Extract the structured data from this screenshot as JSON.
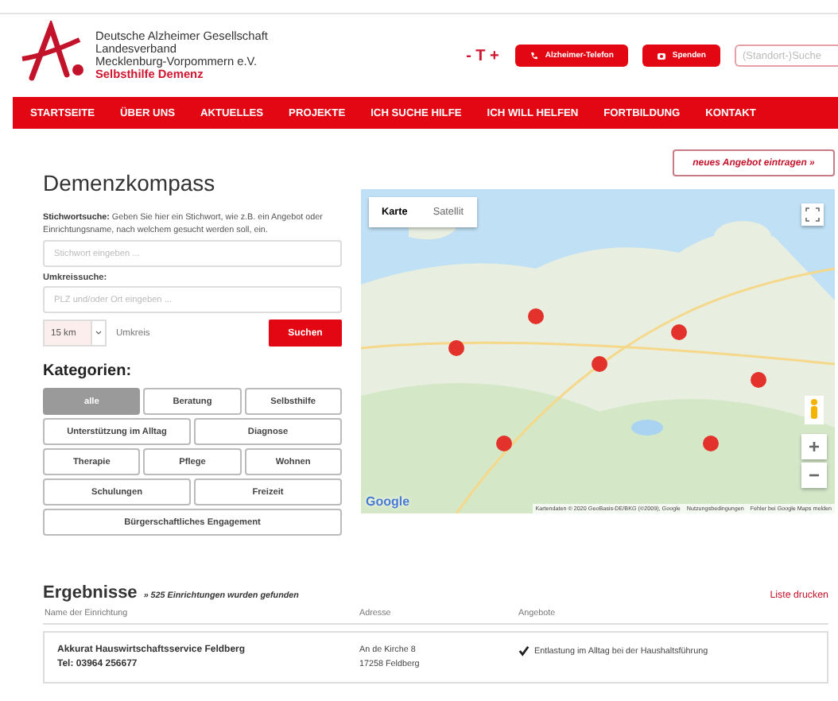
{
  "header": {
    "org_lines": [
      "Deutsche Alzheimer Gesellschaft",
      "Landesverband",
      "Mecklenburg-Vorpommern e.V."
    ],
    "tagline": "Selbsthilfe Demenz",
    "text_size": "- T +",
    "buttons": [
      {
        "label": "Alzheimer-Telefon",
        "kind": "phone"
      },
      {
        "label": "Spenden",
        "kind": "gift"
      }
    ],
    "search": {
      "placeholder": "(Standort-)Suche"
    }
  },
  "nav": [
    {
      "label": "STARTSEITE"
    },
    {
      "label": "ÜBER UNS"
    },
    {
      "label": "AKTUELLES"
    },
    {
      "label": "PROJEKTE"
    },
    {
      "label": "ICH SUCHE HILFE"
    },
    {
      "label": "ICH WILL HELFEN"
    },
    {
      "label": "FORTBILDUNG"
    },
    {
      "label": "KONTAKT"
    }
  ],
  "page_title": "Demenzkompass",
  "add_button": "neues Angebot eintragen »",
  "keyword_search": {
    "hint": "**Stichwortsuche:** Geben Sie hier ein Stichwort, wie z.B. ein Angebot oder Einrichtungsname, nach welchem gesucht werden soll, ein.",
    "placeholder": "Stichwort eingeben ..."
  },
  "radius_search": {
    "label": "Umkreissuche:",
    "placeholder": "PLZ und/oder Ort eingeben ...",
    "radius": "15 km",
    "radius_label": "Umkreis",
    "button": "Suchen"
  },
  "categories": {
    "heading": "Kategorien:",
    "rows": [
      [
        {
          "label": "alle",
          "selected": true
        },
        {
          "label": "Beratung",
          "selected": false
        },
        {
          "label": "Selbsthilfe",
          "selected": false
        }
      ],
      [
        {
          "label": "Unterstützung im Alltag",
          "selected": false
        },
        {
          "label": "Diagnose",
          "selected": false
        }
      ],
      [
        {
          "label": "Therapie",
          "selected": false
        },
        {
          "label": "Pflege",
          "selected": false
        },
        {
          "label": "Wohnen",
          "selected": false
        }
      ],
      [
        {
          "label": "Schulungen",
          "selected": false
        },
        {
          "label": "Freizeit",
          "selected": false
        }
      ],
      [
        {
          "label": "Bürgerschaftliches Engagement",
          "selected": false
        }
      ]
    ]
  },
  "map": {
    "tabs": [
      {
        "label": "Karte",
        "selected": true
      },
      {
        "label": "Satellit",
        "selected": false
      }
    ],
    "logo": "Google",
    "attribution": [
      "Kartendaten © 2020 GeoBasis-DE/BKG (©2009), Google",
      "Nutzungsbedingungen",
      "Fehler bei Google Maps melden"
    ],
    "zoom_in": "+",
    "zoom_out": "−"
  },
  "results": {
    "heading": "Ergebnisse",
    "count": "» 525 Einrichtungen wurden gefunden",
    "print": "Liste drucken",
    "columns": [
      "Name der Einrichtung",
      "Adresse",
      "Angebote"
    ],
    "rows": [
      {
        "name": "Akkurat Hauswirtschaftsservice Feldberg",
        "phone": "Tel: 03964 256677",
        "address": [
          "An de Kirche 8",
          "17258 Feldberg"
        ],
        "offers": [
          {
            "label": "Entlastung im Alltag bei der Haushaltsführung",
            "checked": true
          }
        ]
      }
    ]
  }
}
